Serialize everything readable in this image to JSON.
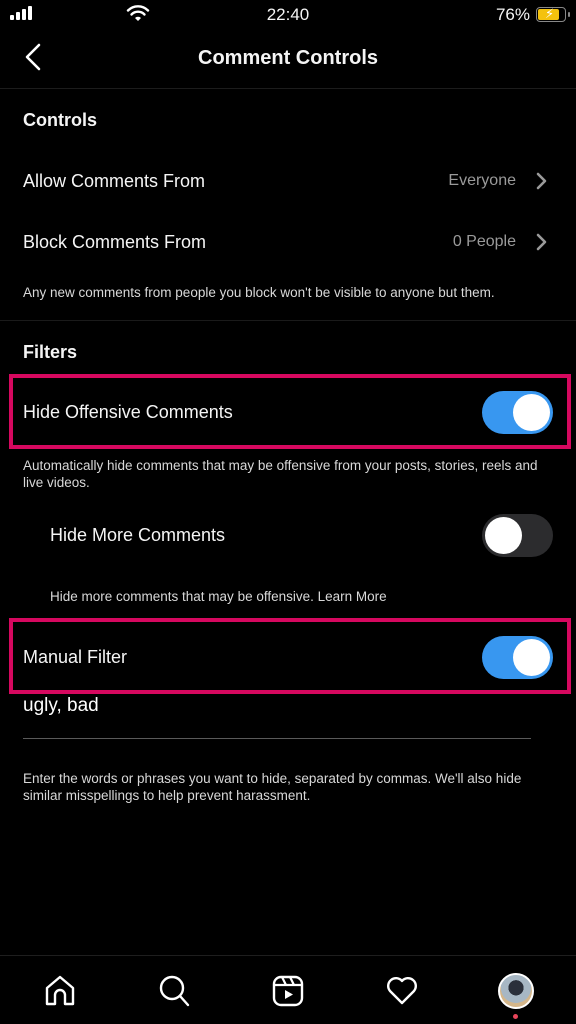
{
  "status_bar": {
    "time": "22:40",
    "battery_percent": "76%",
    "battery_level": 0.76,
    "charging": true
  },
  "header": {
    "title": "Comment Controls",
    "back_icon": "chevron-left-icon"
  },
  "controls": {
    "section_title": "Controls",
    "rows": [
      {
        "label": "Allow Comments From",
        "value": "Everyone"
      },
      {
        "label": "Block Comments From",
        "value": "0 People"
      }
    ],
    "description": "Any new comments from people you block won't be visible to anyone but them."
  },
  "filters": {
    "section_title": "Filters",
    "hide_offensive": {
      "label": "Hide Offensive Comments",
      "enabled": true,
      "description": "Automatically hide comments that may be offensive from your posts, stories, reels and live videos."
    },
    "hide_more": {
      "label": "Hide More Comments",
      "enabled": false,
      "description": "Hide more comments that may be offensive.",
      "link": "Learn More"
    },
    "manual_filter": {
      "label": "Manual Filter",
      "enabled": true,
      "input_value": "ugly, bad",
      "description": "Enter the words or phrases you want to hide, separated by commas. We'll also hide similar misspellings to help prevent harassment."
    }
  },
  "highlight_color": "#d6085f",
  "accent_color": "#3897f0",
  "tab_bar": {
    "items": [
      {
        "name": "home",
        "icon": "home-icon"
      },
      {
        "name": "search",
        "icon": "search-icon"
      },
      {
        "name": "reels",
        "icon": "reels-icon"
      },
      {
        "name": "activity",
        "icon": "heart-icon"
      },
      {
        "name": "profile",
        "icon": "avatar"
      }
    ]
  }
}
